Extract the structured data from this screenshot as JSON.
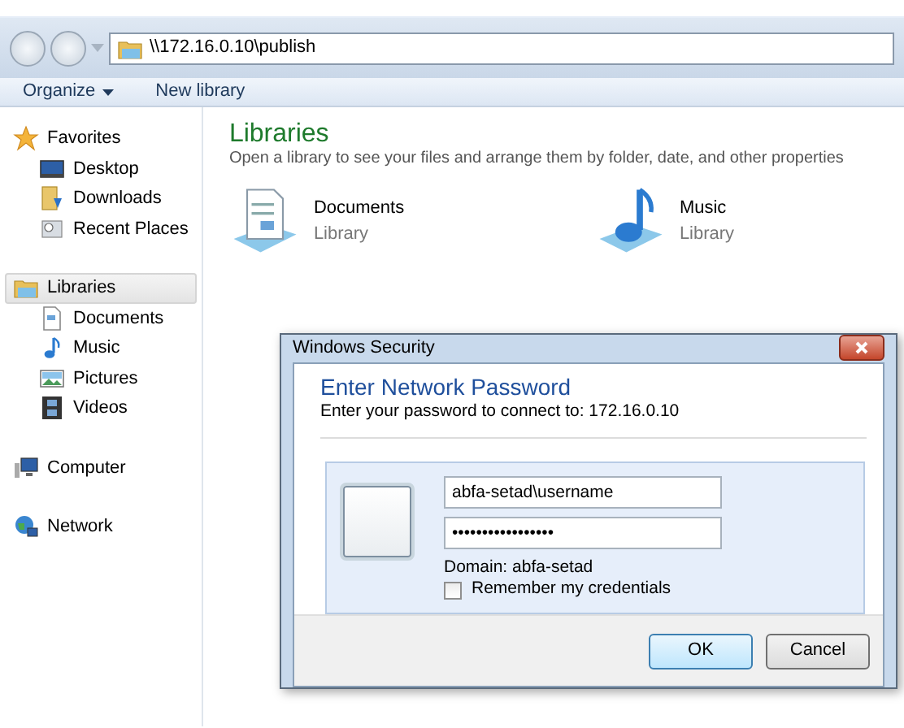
{
  "address_bar": {
    "path": "\\\\172.16.0.10\\publish"
  },
  "toolbar": [
    {
      "label": "Organize",
      "dropdown": true
    },
    {
      "label": "New library",
      "dropdown": false
    }
  ],
  "sidebar": {
    "groups": [
      {
        "label": "Favorites",
        "kind": "star",
        "selected": false,
        "children": [
          {
            "label": "Desktop",
            "kind": "desktop",
            "selected": false
          },
          {
            "label": "Downloads",
            "kind": "downloads",
            "selected": false
          },
          {
            "label": "Recent Places",
            "kind": "recent",
            "selected": false
          }
        ]
      },
      {
        "label": "Libraries",
        "kind": "libraries",
        "selected": true,
        "children": [
          {
            "label": "Documents",
            "kind": "document",
            "selected": false
          },
          {
            "label": "Music",
            "kind": "music",
            "selected": false
          },
          {
            "label": "Pictures",
            "kind": "pictures",
            "selected": false
          },
          {
            "label": "Videos",
            "kind": "videos",
            "selected": false
          }
        ]
      },
      {
        "label": "Computer",
        "kind": "computer",
        "selected": false
      },
      {
        "label": "Network",
        "kind": "network",
        "selected": false
      }
    ]
  },
  "content": {
    "title": "Libraries",
    "subtitle": "Open a library to see your files and arrange them by folder, date, and other properties",
    "libraries": [
      {
        "name": "Documents",
        "type": "Library",
        "kind": "documents"
      },
      {
        "name": "Music",
        "type": "Library",
        "kind": "music"
      }
    ]
  },
  "dialog": {
    "title": "Windows Security",
    "heading": "Enter Network Password",
    "message": "Enter your password to connect to: 172.16.0.10",
    "username": "abfa-setad\\username",
    "password": "•••••••••••••••••",
    "domain": "Domain: abfa-setad",
    "remember": {
      "label": "Remember my credentials",
      "checked": false
    },
    "buttons": [
      {
        "label": "OK",
        "default": true
      },
      {
        "label": "Cancel",
        "default": false
      }
    ]
  }
}
